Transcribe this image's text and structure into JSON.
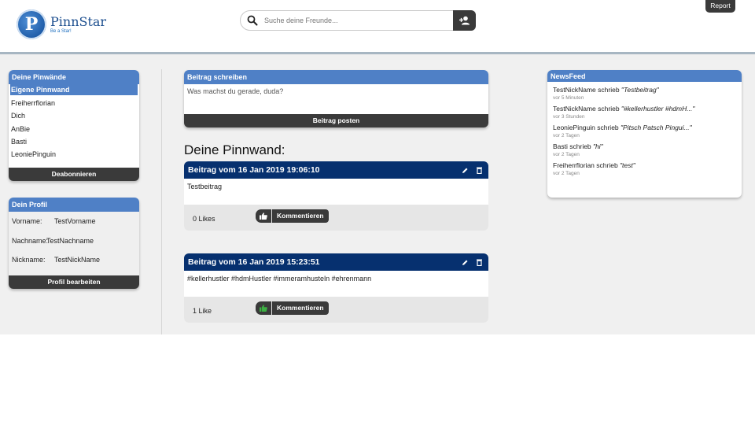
{
  "app": {
    "name": "PinnStar",
    "tagline": "Be a Star!",
    "logo_letter": "P"
  },
  "search": {
    "placeholder": "Suche deine Freunde...",
    "value": ""
  },
  "header": {
    "report_label": "Report"
  },
  "sidebar": {
    "pinwaende": {
      "title": "Deine Pinwände",
      "items": [
        {
          "label": "Eigene Pinnwand",
          "active": true
        },
        {
          "label": "Freiherrflorian"
        },
        {
          "label": "Dich"
        },
        {
          "label": "AnBie"
        },
        {
          "label": "Basti"
        },
        {
          "label": "LeoniePinguin"
        }
      ],
      "action_label": "Deabonnieren"
    },
    "profile": {
      "title": "Dein Profil",
      "rows": [
        {
          "key": "Vorname:",
          "value": "TestVorname"
        },
        {
          "key": "Nachname:",
          "value": "TestNachname"
        },
        {
          "key": "Nickname:",
          "value": "TestNickName"
        }
      ],
      "action_label": "Profil bearbeiten"
    }
  },
  "composer": {
    "title": "Beitrag schreiben",
    "placeholder": "Was machst du gerade, duda?",
    "submit_label": "Beitrag posten"
  },
  "wall": {
    "title": "Deine Pinnwand:",
    "posts": [
      {
        "header": "Beitrag vom 16 Jan 2019 19:06:10",
        "body": "Testbeitrag",
        "likes": "0  Likes",
        "liked": false,
        "comment_label": "Kommentieren"
      },
      {
        "header": "Beitrag vom 16 Jan 2019 15:23:51",
        "body": "#kellerhustler #hdmHustler #immeramhusteln  #ehrenmann",
        "likes": "1  Like",
        "liked": true,
        "comment_label": "Kommentieren"
      }
    ]
  },
  "newsfeed": {
    "title": "NewsFeed",
    "items": [
      {
        "text": "TestNickName schrieb ",
        "quote": "\"Testbeitrag\"",
        "time": "vor 5 Minuten"
      },
      {
        "text": "TestNickName schrieb ",
        "quote": "\"#kellerhustler #hdmH...\"",
        "time": "vor 3 Stunden"
      },
      {
        "text": "LeoniePinguin schrieb ",
        "quote": "\"Pitsch Patsch Pingui...\"",
        "time": "vor 2 Tagen"
      },
      {
        "text": "Basti schrieb ",
        "quote": "\"hi\"",
        "time": "vor 2 Tagen"
      },
      {
        "text": "Freiherrflorian schrieb ",
        "quote": "\"test\"",
        "time": "vor 2 Tagen"
      }
    ]
  },
  "colors": {
    "accent": "#4f80c6",
    "post_header": "#06306f",
    "dark": "#3a3a3a",
    "like_active": "#3cb043"
  }
}
